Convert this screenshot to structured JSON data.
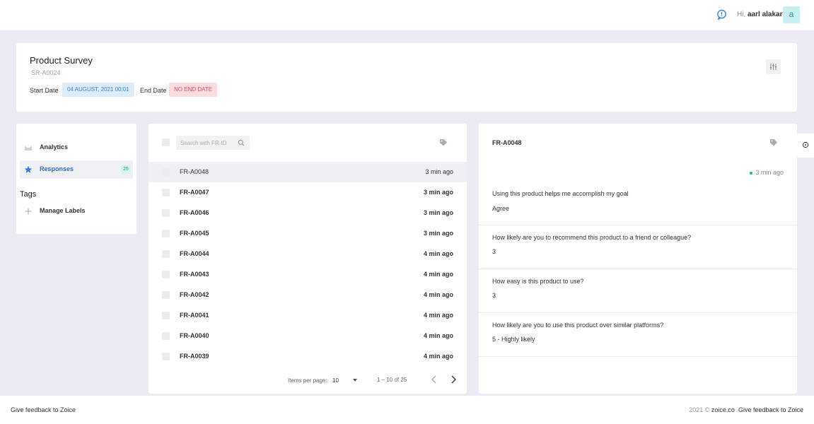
{
  "header": {
    "greeting_prefix": "Hi,",
    "user_name": "aarl alakar",
    "avatar_letter": "a"
  },
  "survey": {
    "title": "Product Survey",
    "id": "SR-A0024",
    "start_label": "Start Date",
    "start_value": "04 AUGUST, 2021 00:01",
    "end_label": "End Date",
    "end_value": "NO END DATE"
  },
  "sidebar": {
    "analytics_label": "Analytics",
    "responses_label": "Responses",
    "responses_count": "25",
    "tags_heading": "Tags",
    "manage_labels": "Manage Labels"
  },
  "responses": {
    "search_placeholder": "Search with FR-ID",
    "rows": [
      {
        "id": "FR-A0048",
        "time": "3 min ago"
      },
      {
        "id": "FR-A0047",
        "time": "3 min ago"
      },
      {
        "id": "FR-A0046",
        "time": "3 min ago"
      },
      {
        "id": "FR-A0045",
        "time": "3 min ago"
      },
      {
        "id": "FR-A0044",
        "time": "4 min ago"
      },
      {
        "id": "FR-A0043",
        "time": "4 min ago"
      },
      {
        "id": "FR-A0042",
        "time": "4 min ago"
      },
      {
        "id": "FR-A0041",
        "time": "4 min ago"
      },
      {
        "id": "FR-A0040",
        "time": "4 min ago"
      },
      {
        "id": "FR-A0039",
        "time": "4 min ago"
      }
    ],
    "pager": {
      "items_label": "Items per page:",
      "items_value": "10",
      "range": "1 – 10 of 25"
    }
  },
  "detail": {
    "id": "FR-A0048",
    "time": "3 min ago",
    "answers": [
      {
        "q": "Using this product helps me accomplish my goal",
        "a": "Agree"
      },
      {
        "q": "How likely are you to recommend this product to a friend or colleague?",
        "a": "3"
      },
      {
        "q": "How easy is this product to use?",
        "a": "3"
      },
      {
        "q": "How likely are you to use this product over similar platforms?",
        "a": "5 - Highly likely"
      }
    ]
  },
  "footer": {
    "left": "Give feedback to Zoice",
    "year": "2021 ©",
    "site": "zoice.co",
    "right": "Give feedback to Zoice"
  }
}
